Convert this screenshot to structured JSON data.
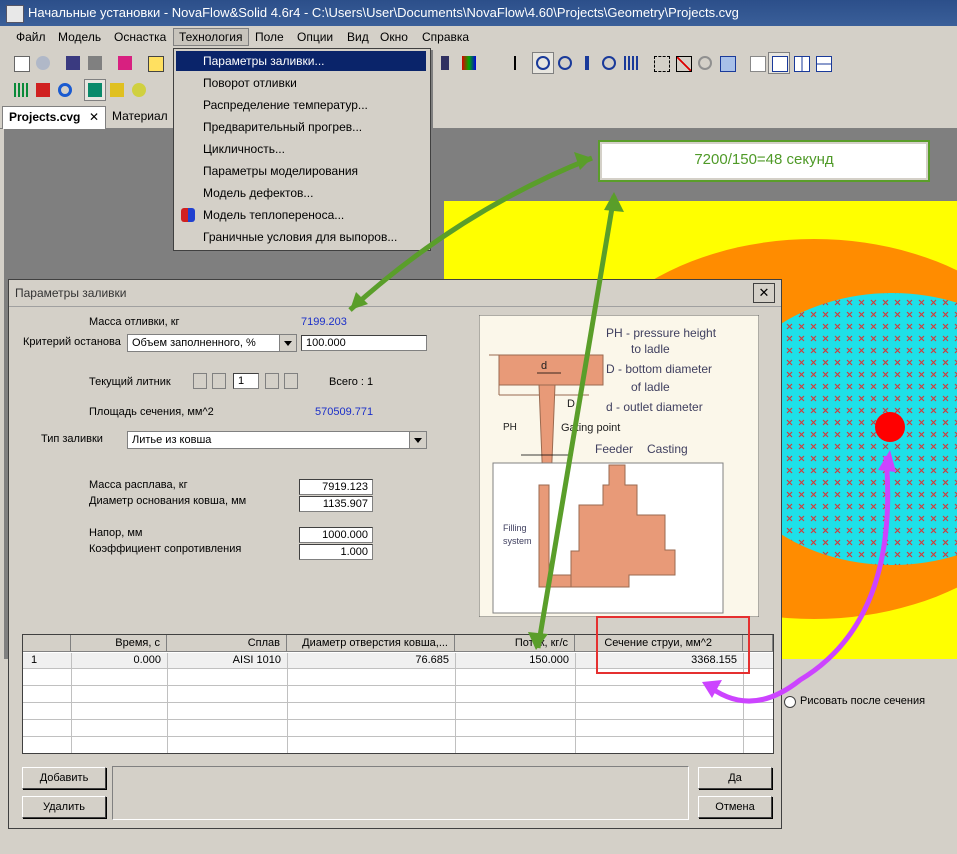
{
  "window": {
    "title": "Начальные установки - NovaFlow&Solid 4.6r4 - C:\\Users\\User\\Documents\\NovaFlow\\4.60\\Projects\\Geometry\\Projects.cvg"
  },
  "menubar": {
    "items": [
      "Файл",
      "Модель",
      "Оснастка",
      "Технология",
      "Поле",
      "Опции",
      "Вид",
      "Окно",
      "Справка"
    ],
    "active": "Технология"
  },
  "tech_menu": {
    "items": [
      "Параметры заливки...",
      "Поворот отливки",
      "Распределение температур...",
      "Предварительный прогрев...",
      "Цикличность...",
      "Параметры моделирования",
      "Модель дефектов...",
      "Модель теплопереноса...",
      "Граничные условия для выпоров..."
    ],
    "selected_index": 0
  },
  "tabs": {
    "items": [
      "Projects.cvg",
      "Материал"
    ],
    "close_glyph": "✕"
  },
  "annotation": {
    "text": "7200/150=48 секунд",
    "color": "#4f9a28"
  },
  "dialog": {
    "title": "Параметры заливки",
    "close_glyph": "✕",
    "mass_label": "Масса отливки, кг",
    "mass_value": "7199.203",
    "stop_label": "Критерий останова",
    "stop_value": "Объем заполненного, %",
    "stop_number": "100.000",
    "gate_label": "Текущий литник",
    "gate_value": "1",
    "gate_total": "Всего : 1",
    "area_label": "Площадь сечения, мм^2",
    "area_value": "570509.771",
    "pour_label": "Тип заливки",
    "pour_value": "Литье из ковша",
    "melt_label": "Масса расплава, кг",
    "melt_value": "7919.123",
    "ladle_label": "Диаметр основания ковша, мм",
    "ladle_value": "1135.907",
    "head_label": "Напор, мм",
    "head_value": "1000.000",
    "resist_label": "Коэффициент сопротивления",
    "resist_value": "1.000",
    "grid": {
      "headers": [
        "",
        "Время, с",
        "Сплав",
        "Диаметр отверстия ковша,...",
        "Поток, кг/с",
        "Сечение струи, мм^2"
      ],
      "row": [
        "1",
        "0.000",
        "AISI 1010",
        "76.685",
        "150.000",
        "3368.155"
      ]
    },
    "buttons": {
      "add": "Добавить",
      "delete": "Удалить",
      "ok": "Да",
      "cancel": "Отмена"
    }
  },
  "diagram": {
    "legend": [
      "PH - pressure height",
      "to ladle",
      "D - bottom diameter",
      "of ladle",
      "d - outlet diameter"
    ],
    "labels": {
      "d": "d",
      "D": "D",
      "PH": "PH",
      "gating": "Gating point",
      "feeder": "Feeder",
      "casting": "Casting",
      "filling1": "Filling",
      "filling2": "system"
    }
  },
  "side": {
    "radio_label": "Рисовать после сечения"
  },
  "colors": {
    "yellow": "#ffff00",
    "orange": "#ff8c00",
    "cyan": "#1ee0e8",
    "red": "#ff0000",
    "green_arrow": "#5a9e2a",
    "magenta_arrow": "#cc44ff",
    "highlight": "#e53030"
  }
}
